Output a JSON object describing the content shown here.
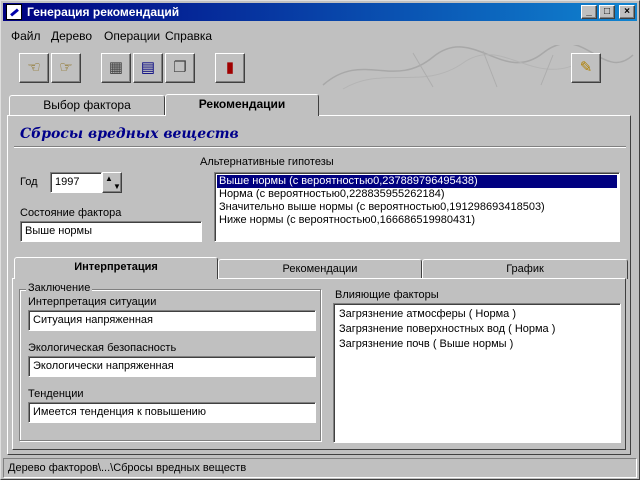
{
  "window": {
    "title": "Генерация рекомендаций"
  },
  "title_buttons": {
    "minimize": "_",
    "maximize": "□",
    "close": "×"
  },
  "menu": [
    "Файл",
    "Дерево",
    "Операции",
    "Справка"
  ],
  "toolbar": {
    "buttons": [
      {
        "name": "back",
        "icon": "hand-left-icon",
        "glyph": "☜"
      },
      {
        "name": "forward",
        "icon": "hand-right-icon",
        "glyph": "☞"
      },
      {
        "name": "calculator",
        "icon": "calculator-icon",
        "glyph": "▦"
      },
      {
        "name": "table",
        "icon": "table-icon",
        "glyph": "▤"
      },
      {
        "name": "report",
        "icon": "documents-icon",
        "glyph": "❐"
      },
      {
        "name": "exit",
        "icon": "door-exit-icon",
        "glyph": "▮"
      },
      {
        "name": "help",
        "icon": "help-book-icon",
        "glyph": "✎"
      }
    ]
  },
  "main_tabs": [
    {
      "label": "Выбор фактора",
      "active": false
    },
    {
      "label": "Рекомендации",
      "active": true
    }
  ],
  "section_title": "Сбросы вредных веществ",
  "year": {
    "label": "Год",
    "value": "1997"
  },
  "factor_state": {
    "label": "Состояние фактора",
    "value": "Выше нормы"
  },
  "hypotheses": {
    "label": "Альтернативные гипотезы",
    "items": [
      {
        "text": "Выше нормы (с вероятностью0,237889796495438)",
        "selected": true
      },
      {
        "text": "Норма (с вероятностью0,228835955262184)",
        "selected": false
      },
      {
        "text": "Значительно выше нормы (с вероятностью0,191298693418503)",
        "selected": false
      },
      {
        "text": "Ниже нормы (с вероятностью0,166686519980431)",
        "selected": false
      }
    ]
  },
  "inner_tabs": [
    {
      "label": "Интерпретация",
      "active": true
    },
    {
      "label": "Рекомендации",
      "active": false
    },
    {
      "label": "График",
      "active": false
    }
  ],
  "conclusion": {
    "legend": "Заключение",
    "situation": {
      "label": "Интерпретация ситуации",
      "value": "Ситуация  напряженная"
    },
    "ecology": {
      "label": "Экологическая безопасность",
      "value": "Экологически напряженная"
    },
    "trends": {
      "label": "Тенденции",
      "value": "Имеется тенденция к повышению"
    }
  },
  "influencing": {
    "label": "Влияющие факторы",
    "items": [
      "Загрязнение атмосферы   ( Норма )",
      "Загрязнение поверхностных вод   ( Норма )",
      "Загрязнение почв   ( Выше нормы )"
    ]
  },
  "status": "Дерево факторов\\...\\Сбросы вредных веществ"
}
